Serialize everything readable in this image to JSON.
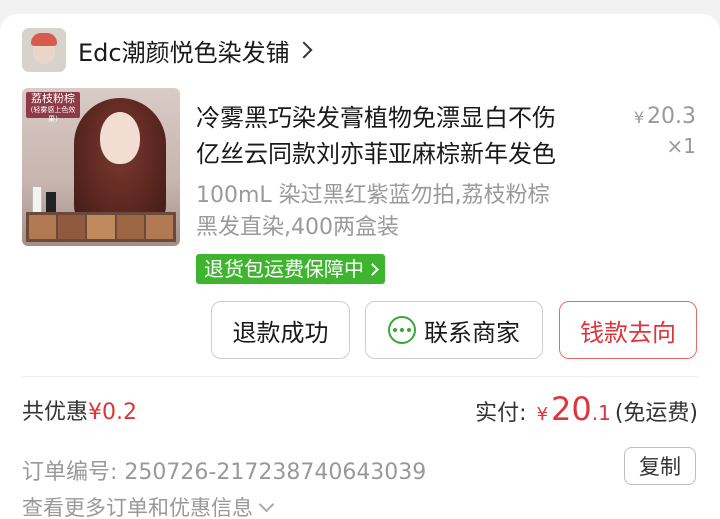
{
  "shop": {
    "name": "Edc潮颜悦色染发铺"
  },
  "product": {
    "title_line1": "冷雾黑巧染发膏植物免漂显白不伤",
    "title_line2": "亿丝云同款刘亦菲亚麻棕新年发色",
    "price_symbol": "¥",
    "price_int": "20",
    "price_dec": ".3",
    "quantity": "×1",
    "spec_line1": "100mL 染过黑红紫蓝勿拍,荔枝粉棕",
    "spec_line2": "黑发直染,400两盒装",
    "image_badge": "荔枝粉棕",
    "image_badge_sub": "(轻雾感上色效果)",
    "service_tag": "退货包运费保障中"
  },
  "actions": {
    "refund": "退款成功",
    "contact": "联系商家",
    "money_flow": "钱款去向"
  },
  "summary": {
    "discount_label": "共优惠",
    "discount_value": "¥0.2",
    "paid_label": "实付:",
    "paid_symbol": "¥",
    "paid_int": "20",
    "paid_dec": ".1",
    "shipping_note": "(免运费)"
  },
  "order": {
    "number_label": "订单编号:",
    "number": "250726-217238740643039",
    "copy": "复制",
    "more": "查看更多订单和优惠信息"
  },
  "colors": {
    "accent_red": "#e0333a",
    "tag_green": "#3fb52f"
  }
}
